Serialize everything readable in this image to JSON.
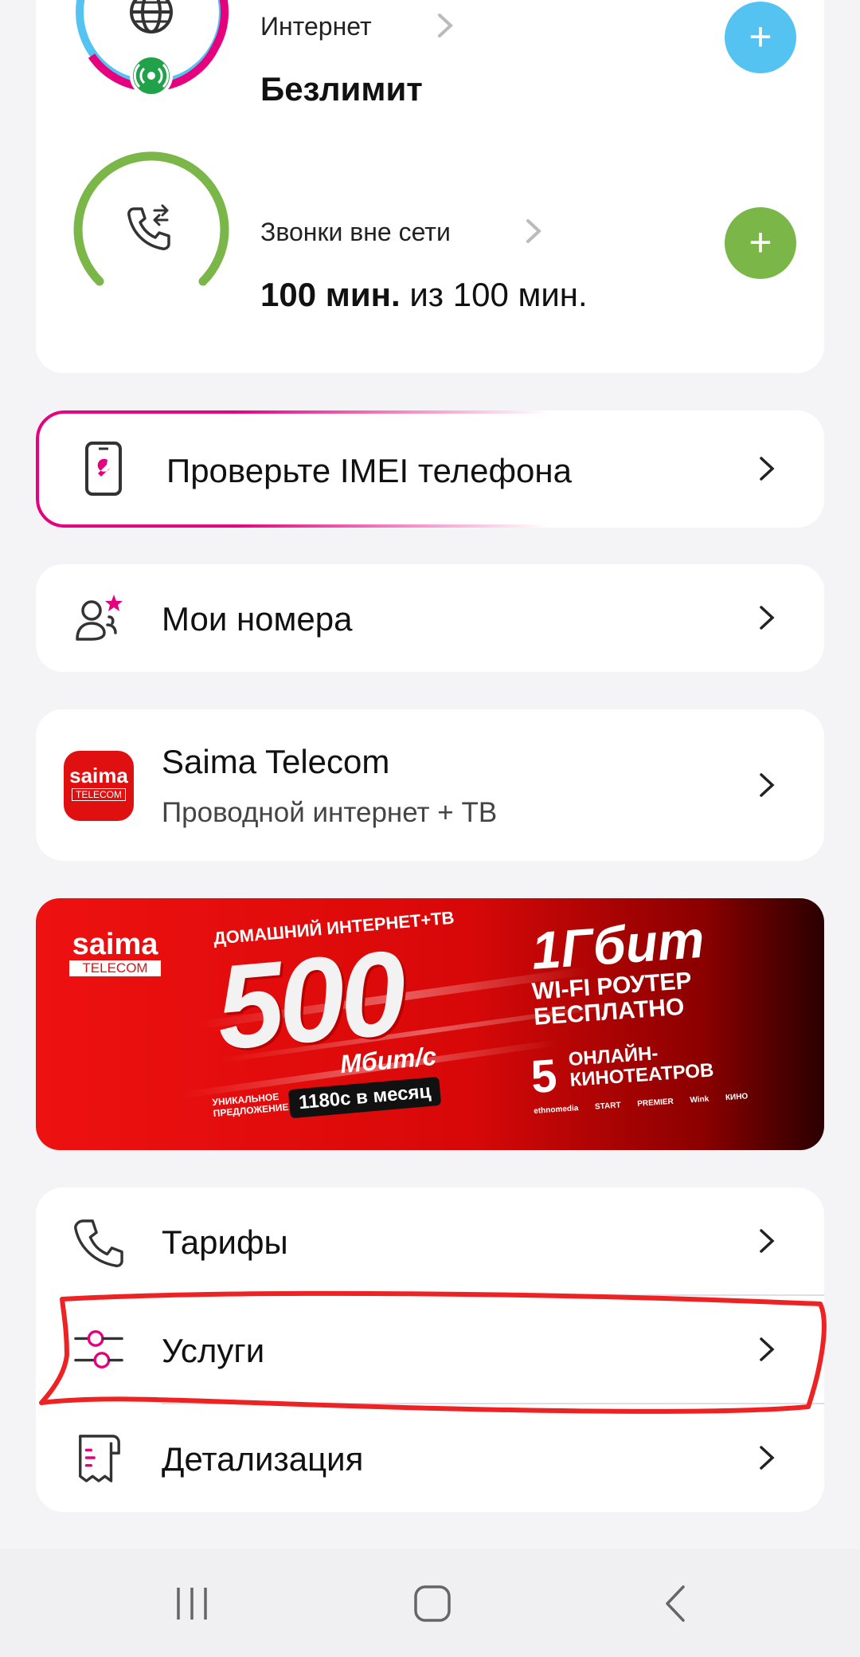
{
  "usage": {
    "internet": {
      "title": "Интернет",
      "value": "Безлимит",
      "plus": "+"
    },
    "calls": {
      "title": "Звонки вне сети",
      "value_bold": "100 мин.",
      "value_rest": " из 100 мин.",
      "plus": "+"
    }
  },
  "imei": {
    "label": "Проверьте IMEI телефона"
  },
  "my_numbers": {
    "label": "Мои номера"
  },
  "saima": {
    "title": "Saima Telecom",
    "subtitle": "Проводной интернет + ТВ",
    "logo_top": "saima",
    "logo_bottom": "TELECOM"
  },
  "banner": {
    "logo_top": "saima",
    "logo_bottom": "TELECOM",
    "heading": "ДОМАШНИЙ ИНТЕРНЕТ+ТВ",
    "speed": "500",
    "speed_unit": "Мбит/с",
    "unique_line1": "УНИКАЛЬНОЕ",
    "unique_line2": "ПРЕДЛОЖЕНИЕ",
    "price": "1180с в месяц",
    "gbit": "1Гбит",
    "router_line1": "WI-FI РОУТЕР",
    "router_line2": "БЕСПЛАТНО",
    "cinema_count": "5",
    "cinema_line1": "ОНЛАЙН-",
    "cinema_line2": "КИНОТЕАТРОВ",
    "partners": [
      "ethnomedia",
      "START",
      "PREMIER",
      "Wink",
      "КИНО"
    ]
  },
  "menu": {
    "tariffs": "Тарифы",
    "services": "Услуги",
    "details": "Детализация"
  },
  "colors": {
    "accent_pink": "#e6007e",
    "internet_blue": "#55c3f2",
    "calls_green": "#7ab648",
    "signal_green": "#21a14a",
    "banner_red": "#e01010"
  }
}
